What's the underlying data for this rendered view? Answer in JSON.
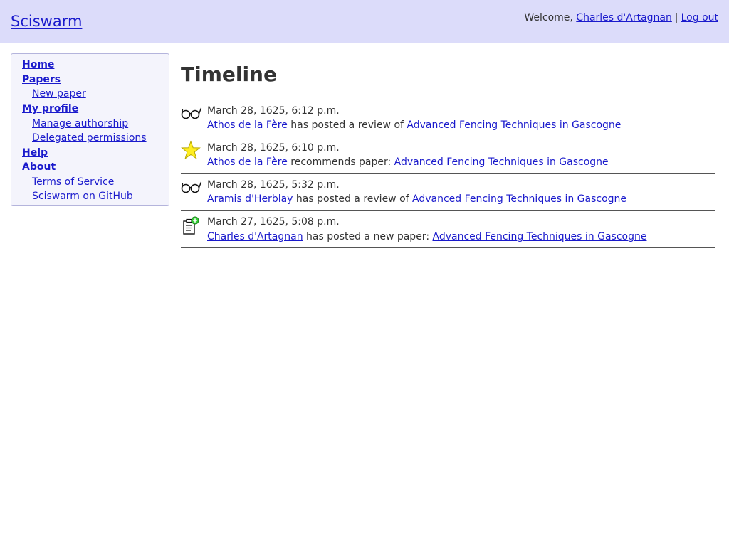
{
  "header": {
    "site_title": "Sciswarm",
    "welcome_text": "Welcome,",
    "user_name": "Charles d'Artagnan",
    "separator": "|",
    "logout_label": "Log out"
  },
  "sidebar": {
    "home": "Home",
    "papers": "Papers",
    "new_paper": "New paper",
    "my_profile": "My profile",
    "manage_authorship": "Manage authorship",
    "delegated_permissions": "Delegated permissions",
    "help": "Help",
    "about": "About",
    "terms_of_service": "Terms of Service",
    "github": "Sciswarm on GitHub"
  },
  "main": {
    "title": "Timeline",
    "entries": [
      {
        "icon": "glasses-icon",
        "time": "March 28, 1625, 6:12 p.m.",
        "actor": "Athos de la Fère",
        "action": " has posted a review of ",
        "paper": "Advanced Fencing Techniques in Gascogne"
      },
      {
        "icon": "star-icon",
        "time": "March 28, 1625, 6:10 p.m.",
        "actor": "Athos de la Fère",
        "action": " recommends paper: ",
        "paper": "Advanced Fencing Techniques in Gascogne"
      },
      {
        "icon": "glasses-icon",
        "time": "March 28, 1625, 5:32 p.m.",
        "actor": "Aramis d'Herblay",
        "action": " has posted a review of ",
        "paper": "Advanced Fencing Techniques in Gascogne"
      },
      {
        "icon": "new-document-icon",
        "time": "March 27, 1625, 5:08 p.m.",
        "actor": "Charles d'Artagnan",
        "action": " has posted a new paper: ",
        "paper": "Advanced Fencing Techniques in Gascogne"
      }
    ]
  },
  "colors": {
    "header_bg": "#dcdcfa",
    "sidebar_bg": "#f4f4fc",
    "sidebar_border": "#b4b4dc",
    "link": "#1a1acc",
    "text": "#333333",
    "star_fill": "#ffee22",
    "plus_green": "#33cc33"
  }
}
